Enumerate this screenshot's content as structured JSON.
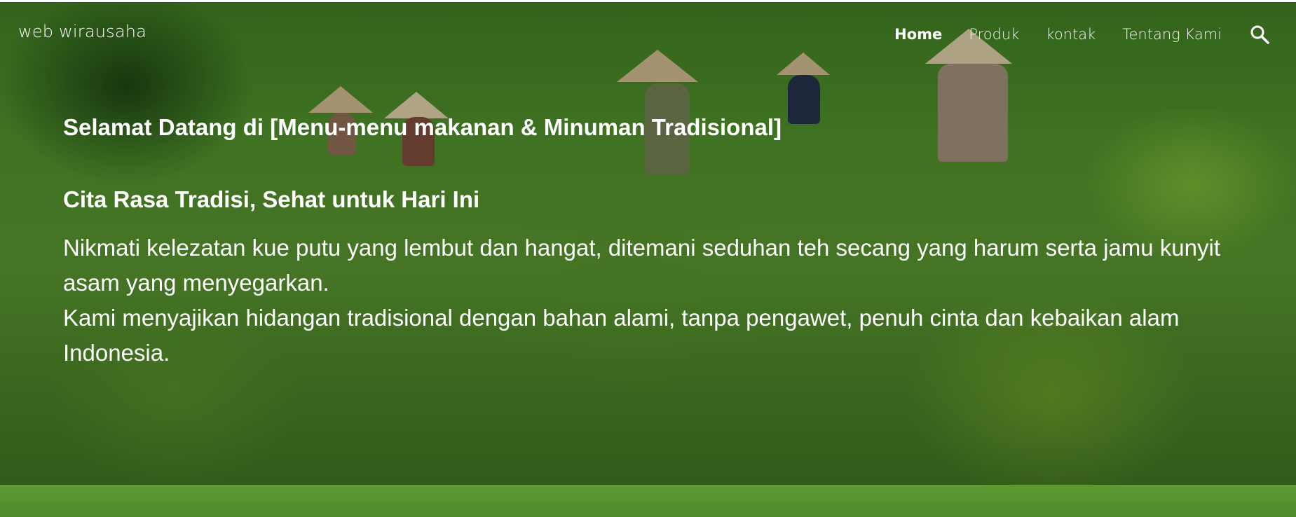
{
  "navbar": {
    "brand": "web wirausaha",
    "links": [
      {
        "label": "Home",
        "active": true
      },
      {
        "label": "Produk",
        "active": false
      },
      {
        "label": "kontak",
        "active": false
      },
      {
        "label": "Tentang Kami",
        "active": false
      }
    ],
    "search_icon": "search-icon"
  },
  "hero": {
    "welcome": "Selamat Datang di [Menu-menu makanan & Minuman Tradisional]",
    "tagline": "Cita Rasa Tradisi, Sehat untuk Hari Ini",
    "paragraph_1": "Nikmati kelezatan kue putu yang lembut dan hangat, ditemani seduhan teh secang yang harum serta jamu kunyit asam yang menyegarkan.",
    "paragraph_2": "Kami menyajikan hidangan tradisional dengan bahan alami, tanpa pengawet, penuh cinta dan kebaikan alam Indonesia."
  },
  "colors": {
    "text": "#ffffff",
    "background_green": "#4e8c2a"
  }
}
